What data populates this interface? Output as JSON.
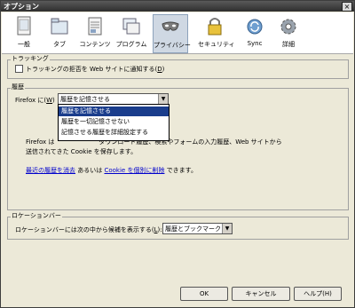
{
  "window": {
    "title": "オプション",
    "close": "×"
  },
  "toolbar": {
    "items": [
      {
        "label": "一般",
        "icon": "general-icon"
      },
      {
        "label": "タブ",
        "icon": "tabs-icon"
      },
      {
        "label": "コンテンツ",
        "icon": "content-icon"
      },
      {
        "label": "プログラム",
        "icon": "applications-icon"
      },
      {
        "label": "プライバシー",
        "icon": "privacy-mask-icon",
        "selected": true
      },
      {
        "label": "セキュリティ",
        "icon": "security-lock-icon"
      },
      {
        "label": "Sync",
        "icon": "sync-icon"
      },
      {
        "label": "詳細",
        "icon": "advanced-gear-icon"
      }
    ]
  },
  "tracking": {
    "heading": "トラッキング",
    "checkbox_label": "トラッキングの拒否を Web サイトに通知する(",
    "checkbox_key": "D",
    "checkbox_end": ")"
  },
  "history": {
    "heading": "履歴",
    "firefox_label": "Firefox に(",
    "firefox_key": "W",
    "firefox_end": ")",
    "selected_value": "履歴を記憶させる",
    "options": [
      "履歴を記憶させる",
      "履歴を一切記憶させない",
      "記憶させる履歴を詳細設定する"
    ],
    "description_line1_prefix": "Firefox は",
    "description_line1_suffix": "ダウンロード履歴、検索やフォームの入力履歴、Web サイトから",
    "description_line2": "送信されてきた Cookie を保存します。",
    "clear_link": "最近の履歴を消去",
    "middle_text": "あるいは",
    "cookie_link": "Cookie を個別に削除",
    "end_text": "できます。"
  },
  "location_bar": {
    "heading": "ロケーションバー",
    "label": "ロケーションバーには次の中から候補を表示する(",
    "label_key": "L",
    "label_end": "):",
    "value": "履歴とブックマーク"
  },
  "buttons": {
    "ok": "OK",
    "cancel": "キャンセル",
    "help": "ヘルプ(H)"
  }
}
